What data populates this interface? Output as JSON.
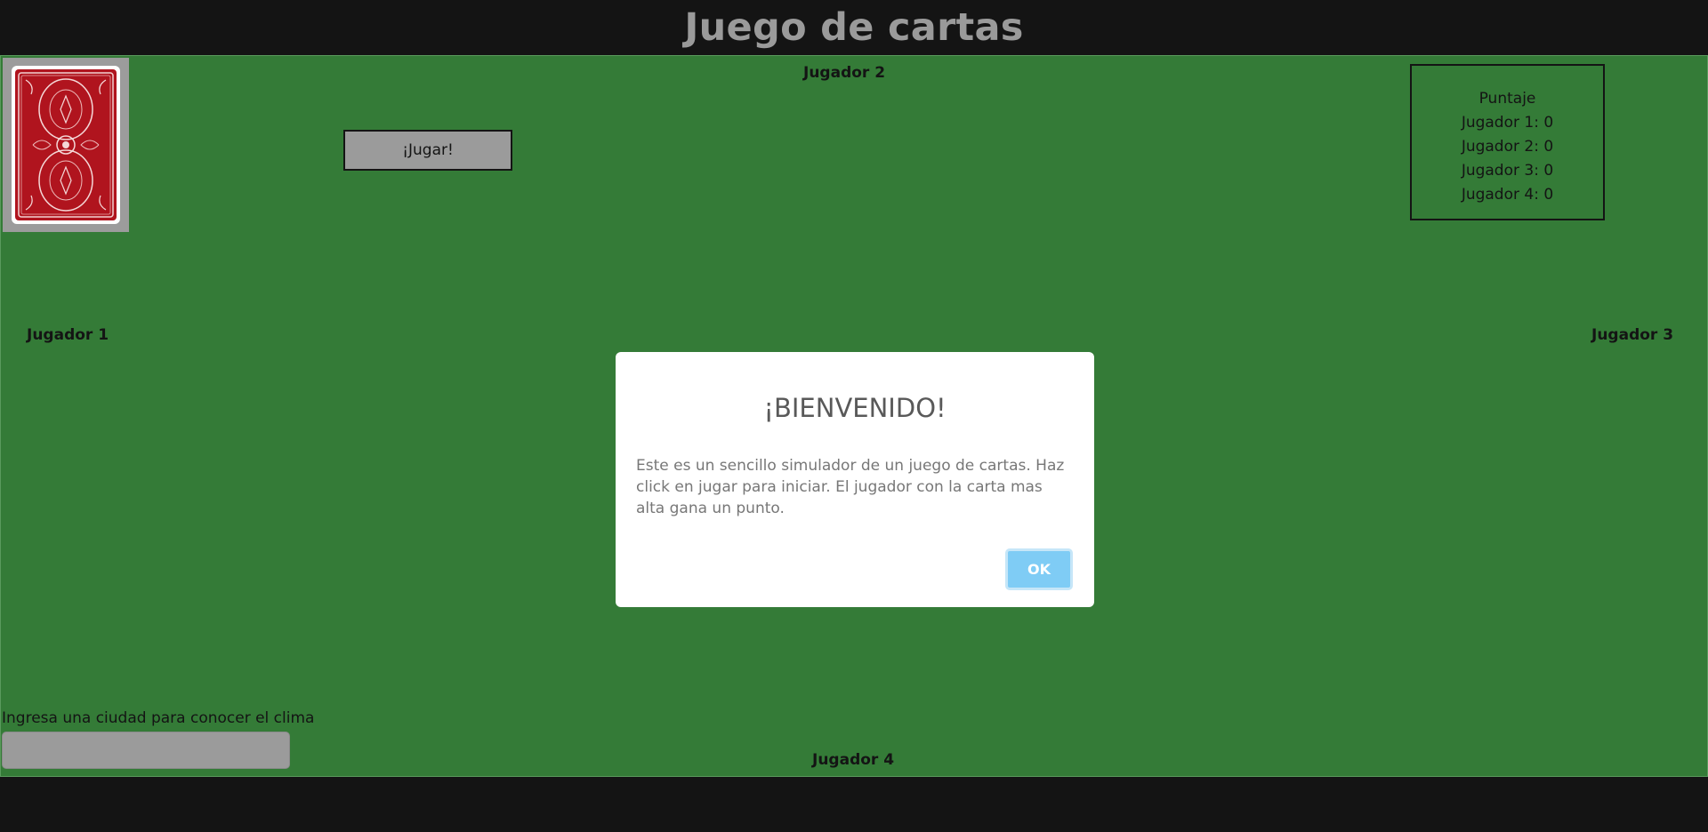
{
  "header": {
    "title": "Juego de cartas"
  },
  "deck": {
    "icon": "card-back-icon",
    "color": "#b0141e"
  },
  "play_button": {
    "label": "¡Jugar!"
  },
  "players": {
    "p1": "Jugador 1",
    "p2": "Jugador 2",
    "p3": "Jugador 3",
    "p4": "Jugador 4"
  },
  "scoreboard": {
    "title": "Puntaje",
    "rows": [
      "Jugador 1: 0",
      "Jugador 2: 0",
      "Jugador 3: 0",
      "Jugador 4: 0"
    ]
  },
  "weather": {
    "label": "Ingresa una ciudad para conocer el clima",
    "value": ""
  },
  "modal": {
    "title": "¡BIENVENIDO!",
    "text": "Este es un sencillo simulador de un juego de cartas. Haz click en jugar para iniciar. El jugador con la carta mas alta gana un punto.",
    "ok_label": "OK"
  },
  "colors": {
    "table": "#347b37",
    "background": "#141414",
    "ok_button": "#7fccf5"
  }
}
